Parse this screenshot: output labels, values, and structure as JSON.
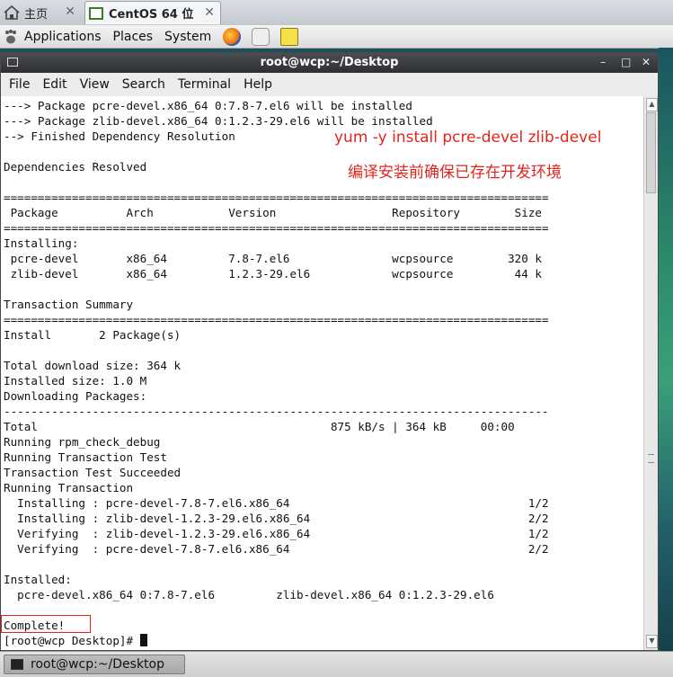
{
  "tabs": [
    {
      "label": "主页",
      "close": "✕",
      "icon": "home-icon"
    },
    {
      "label": "CentOS 64 位",
      "close": "✕",
      "icon": "vm-icon"
    }
  ],
  "panel": {
    "menus": [
      "Applications",
      "Places",
      "System"
    ],
    "icons": [
      "gnome-foot-icon",
      "firefox-icon",
      "network-icon",
      "note-icon"
    ]
  },
  "window": {
    "title": "root@wcp:~/Desktop",
    "controls": {
      "minimize": "–",
      "maximize": "□",
      "close": "✕"
    },
    "menu": [
      "File",
      "Edit",
      "View",
      "Search",
      "Terminal",
      "Help"
    ]
  },
  "terminal": {
    "lines": [
      "---> Package pcre-devel.x86_64 0:7.8-7.el6 will be installed",
      "---> Package zlib-devel.x86_64 0:1.2.3-29.el6 will be installed",
      "--> Finished Dependency Resolution",
      "",
      "Dependencies Resolved",
      "",
      "================================================================================",
      " Package          Arch           Version                 Repository        Size",
      "================================================================================",
      "Installing:",
      " pcre-devel       x86_64         7.8-7.el6               wcpsource        320 k",
      " zlib-devel       x86_64         1.2.3-29.el6            wcpsource         44 k",
      "",
      "Transaction Summary",
      "================================================================================",
      "Install       2 Package(s)",
      "",
      "Total download size: 364 k",
      "Installed size: 1.0 M",
      "Downloading Packages:",
      "--------------------------------------------------------------------------------",
      "Total                                           875 kB/s | 364 kB     00:00",
      "Running rpm_check_debug",
      "Running Transaction Test",
      "Transaction Test Succeeded",
      "Running Transaction",
      "  Installing : pcre-devel-7.8-7.el6.x86_64                                   1/2",
      "  Installing : zlib-devel-1.2.3-29.el6.x86_64                                2/2",
      "  Verifying  : zlib-devel-1.2.3-29.el6.x86_64                                1/2",
      "  Verifying  : pcre-devel-7.8-7.el6.x86_64                                   2/2",
      "",
      "Installed:",
      "  pcre-devel.x86_64 0:7.8-7.el6         zlib-devel.x86_64 0:1.2.3-29.el6",
      "",
      "Complete!"
    ],
    "prompt": "[root@wcp Desktop]# ",
    "annotation_command": "yum -y install pcre-devel zlib-devel",
    "annotation_note": "编译安装前确保已存在开发环境",
    "annotation_color": "#e4241c"
  },
  "taskbar": {
    "item": "root@wcp:~/Desktop"
  }
}
